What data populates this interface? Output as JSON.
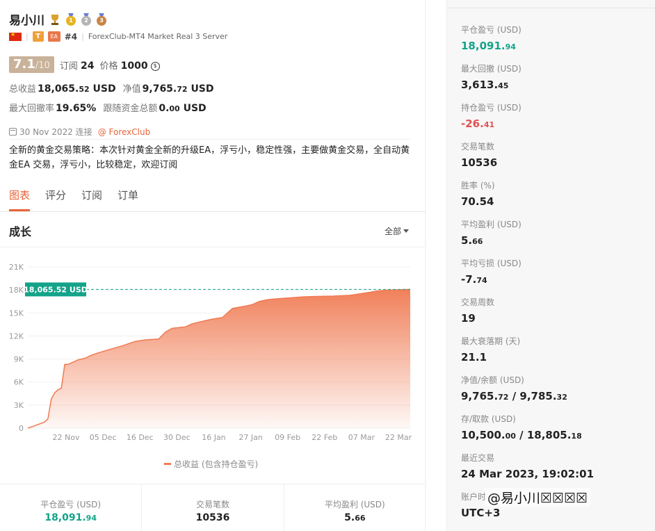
{
  "header": {
    "title": "易小川",
    "medals": [
      "1",
      "2",
      "3"
    ],
    "flag_icon": "china-flag-icon",
    "tag_t": "T",
    "tag_ea": "EA",
    "rank": "#4",
    "server": "ForexClub-MT4 Market Real 3 Server"
  },
  "score": {
    "main": "7.1",
    "sub": "/10"
  },
  "subscribe": {
    "label": "订阅",
    "value": "24"
  },
  "price": {
    "label": "价格",
    "value": "1000",
    "coin": "$"
  },
  "stats": {
    "total_profit_label": "总收益",
    "total_profit_main": "18,065.",
    "total_profit_cents": "52",
    "total_profit_unit": "USD",
    "equity_label": "净值",
    "equity_main": "9,765.",
    "equity_cents": "72",
    "equity_unit": "USD",
    "drawdown_label": "最大回撤率",
    "drawdown_value": "19.65%",
    "follow_label": "跟随资金总额",
    "follow_main": "0.",
    "follow_cents": "00",
    "follow_unit": "USD"
  },
  "meta": {
    "date": "30 Nov 2022 连接",
    "broker": "@ ForexClub"
  },
  "description": "全新的黄金交易策略：本次针对黄金全新的升级EA，浮亏小，稳定性强，主要做黄金交易，全自动黄金EA 交易，浮亏小，比较稳定，欢迎订阅",
  "tabs": [
    "图表",
    "评分",
    "订阅",
    "订单"
  ],
  "chart_section": {
    "title": "成长",
    "range": "全部"
  },
  "chart_data": {
    "type": "area",
    "ylim": [
      0,
      21000
    ],
    "yticks": [
      0,
      3000,
      6000,
      9000,
      12000,
      15000,
      18000,
      21000
    ],
    "ytick_labels": [
      "0",
      "3K",
      "6K",
      "9K",
      "12K",
      "15K",
      "18K",
      "21K"
    ],
    "xtick_labels": [
      "22 Nov",
      "05 Dec",
      "16 Dec",
      "30 Dec",
      "16 Jan",
      "27 Jan",
      "09 Feb",
      "22 Feb",
      "07 Mar",
      "22 Mar"
    ],
    "reference_line_label": "18,065.52 USD",
    "reference_value": 18065.52,
    "legend": "总收益 (包含持仓盈亏)",
    "color": "#f07a52",
    "series": [
      {
        "x": [
          "30 Nov 2022",
          "02 Dec 2022",
          "05 Dec 2022",
          "06 Dec 2022",
          "07 Dec 2022",
          "08 Dec 2022",
          "09 Dec 2022",
          "10 Dec 2022",
          "11 Dec 2022",
          "12 Dec 2022",
          "13 Dec 2022",
          "14 Dec 2022",
          "15 Dec 2022",
          "17 Dec 2022",
          "19 Dec 2022",
          "21 Dec 2022",
          "24 Dec 2022",
          "28 Dec 2022",
          "01 Jan 2023",
          "04 Jan 2023",
          "08 Jan 2023",
          "10 Jan 2023",
          "12 Jan 2023",
          "16 Jan 2023",
          "18 Jan 2023",
          "21 Jan 2023",
          "24 Jan 2023",
          "27 Jan 2023",
          "30 Jan 2023",
          "03 Feb 2023",
          "05 Feb 2023",
          "07 Feb 2023",
          "09 Feb 2023",
          "11 Feb 2023",
          "14 Feb 2023",
          "17 Feb 2023",
          "20 Feb 2023",
          "24 Feb 2023",
          "01 Mar 2023",
          "06 Mar 2023",
          "09 Mar 2023",
          "12 Mar 2023",
          "14 Mar 2023",
          "16 Mar 2023",
          "19 Mar 2023",
          "22 Mar 2023",
          "24 Mar 2023"
        ],
        "y": [
          0,
          300,
          800,
          1200,
          3800,
          4600,
          5000,
          5200,
          8300,
          8300,
          8500,
          8700,
          8900,
          9100,
          9500,
          9800,
          10200,
          10700,
          11300,
          11500,
          11600,
          12500,
          13000,
          13200,
          13600,
          13900,
          14200,
          14400,
          15600,
          15900,
          16100,
          16500,
          16700,
          16800,
          16900,
          17000,
          17100,
          17150,
          17200,
          17300,
          17500,
          17700,
          17850,
          17950,
          18000,
          18050,
          18065.52
        ]
      }
    ]
  },
  "summary": [
    {
      "label": "平仓盈亏 (USD)",
      "main": "18,091.",
      "cents": "94",
      "color": "green"
    },
    {
      "label": "交易笔数",
      "main": "10536",
      "cents": "",
      "color": ""
    },
    {
      "label": "平均盈利 (USD)",
      "main": "5.",
      "cents": "66",
      "color": ""
    }
  ],
  "right_panel": [
    {
      "label": "平仓盈亏 (USD)",
      "main": "18,091.",
      "cents": "94",
      "color": "green"
    },
    {
      "label": "最大回撤 (USD)",
      "main": "3,613.",
      "cents": "45",
      "color": ""
    },
    {
      "label": "持仓盈亏 (USD)",
      "main": "-26.",
      "cents": "41",
      "color": "red"
    },
    {
      "label": "交易笔数",
      "main": "10536",
      "cents": "",
      "color": ""
    },
    {
      "label": "胜率 (%)",
      "main": "70.54",
      "cents": "",
      "color": ""
    },
    {
      "label": "平均盈利 (USD)",
      "main": "5.",
      "cents": "66",
      "color": ""
    },
    {
      "label": "平均亏损 (USD)",
      "main": "-7.",
      "cents": "74",
      "color": ""
    },
    {
      "label": "交易周数",
      "main": "19",
      "cents": "",
      "color": ""
    },
    {
      "label": "最大衰落期 (天)",
      "main": "21.1",
      "cents": "",
      "color": ""
    },
    {
      "label": "净值/余额 (USD)",
      "main": "9,765.",
      "cents": "72",
      "main2": " / 9,785.",
      "cents2": "32",
      "color": ""
    },
    {
      "label": "存/取款 (USD)",
      "main": "10,500.",
      "cents": "00",
      "main2": " / 18,805.",
      "cents2": "18",
      "color": ""
    },
    {
      "label": "最近交易",
      "main": "24 Mar 2023, 19:02:01",
      "cents": "",
      "color": ""
    },
    {
      "label": "账户时",
      "main": "UTC+3",
      "cents": "",
      "color": ""
    }
  ],
  "watermark": "@易小川☒☒☒☒"
}
